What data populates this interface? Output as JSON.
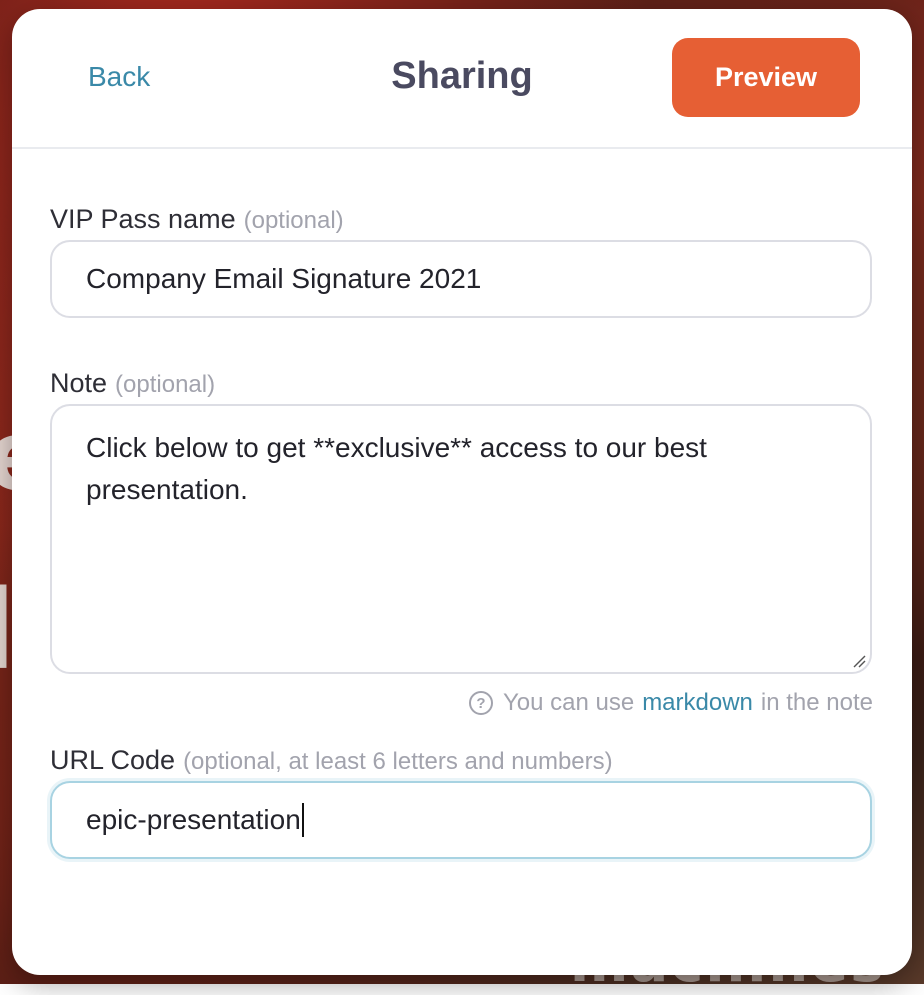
{
  "header": {
    "back_label": "Back",
    "title": "Sharing",
    "preview_label": "Preview"
  },
  "form": {
    "pass_name": {
      "label": "VIP Pass name",
      "hint": "(optional)",
      "value": "Company Email Signature 2021"
    },
    "note": {
      "label": "Note",
      "hint": "(optional)",
      "value": "Click below to get **exclusive** access to our best presentation."
    },
    "markdown_help": {
      "prefix": "You can use",
      "link": "markdown",
      "suffix": "in the note"
    },
    "url_code": {
      "label": "URL Code",
      "hint": "(optional, at least 6 letters and numbers)",
      "value": "epic-presentation"
    }
  },
  "colors": {
    "accent": "#e65f34",
    "link": "#3a89a8",
    "focus_border": "#a8d3e2"
  }
}
